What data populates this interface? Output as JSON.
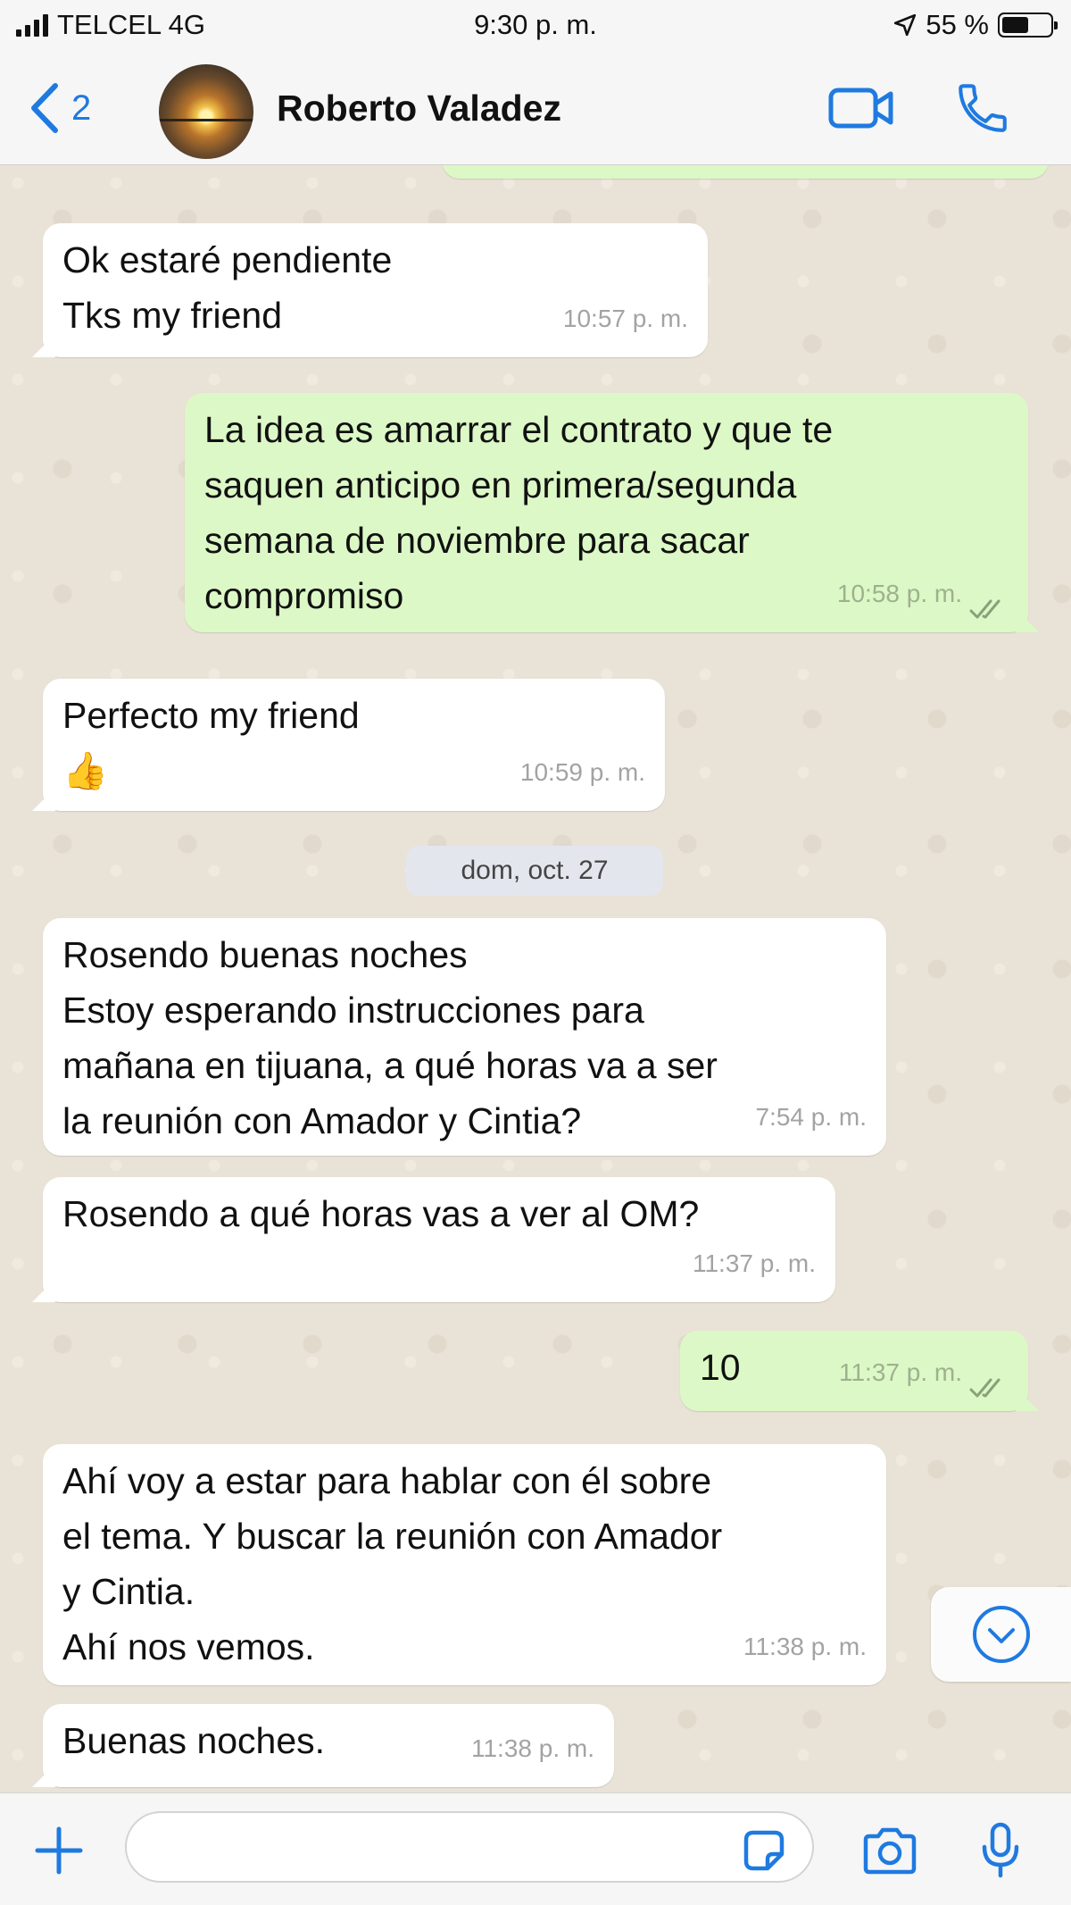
{
  "status_bar": {
    "carrier": "TELCEL 4G",
    "time": "9:30 p. m.",
    "battery": "55 %",
    "battery_level": 0.55
  },
  "header": {
    "back_count": "2",
    "contact_name": "Roberto Valadez"
  },
  "chat": {
    "date_separator": "dom, oct. 27",
    "messages": [
      {
        "direction": "in",
        "text": "Ok estaré pendiente\nTks my friend",
        "time": "10:57 p. m."
      },
      {
        "direction": "out",
        "text": "La idea es amarrar el contrato y que te\nsaquen anticipo en primera/segunda\nsemana de noviembre para sacar\ncompromiso",
        "time": "10:58 p. m.",
        "status": "read"
      },
      {
        "direction": "in",
        "text": "Perfecto my friend\n👍",
        "time": "10:59 p. m."
      },
      {
        "direction": "in",
        "text": "Rosendo buenas noches\nEstoy esperando instrucciones para\nmañana en tijuana, a qué horas va a ser\nla reunión con Amador y Cintia?",
        "time": "7:54 p. m."
      },
      {
        "direction": "in",
        "text": "Rosendo a qué horas vas a ver al OM?",
        "time": "11:37 p. m."
      },
      {
        "direction": "out",
        "text": "10",
        "time": "11:37 p. m.",
        "status": "read"
      },
      {
        "direction": "in",
        "text": "Ahí voy a estar para hablar con él sobre\nel tema. Y buscar la reunión con Amador\ny Cintia.\nAhí nos vemos.",
        "time": "11:38 p. m."
      },
      {
        "direction": "in",
        "text": "Buenas noches.",
        "time": "11:38 p. m."
      }
    ]
  },
  "input_bar": {
    "message_value": "",
    "message_placeholder": ""
  },
  "colors": {
    "accent": "#1f7ae0",
    "incoming_bubble": "#ffffff",
    "outgoing_bubble": "#dcf8c6",
    "chat_background": "#e9e2d6"
  },
  "icons": [
    "back-chevron-icon",
    "video-call-icon",
    "phone-icon",
    "read-ticks-icon",
    "scroll-down-icon",
    "plus-icon",
    "sticker-icon",
    "camera-icon",
    "microphone-icon",
    "location-arrow-icon"
  ]
}
